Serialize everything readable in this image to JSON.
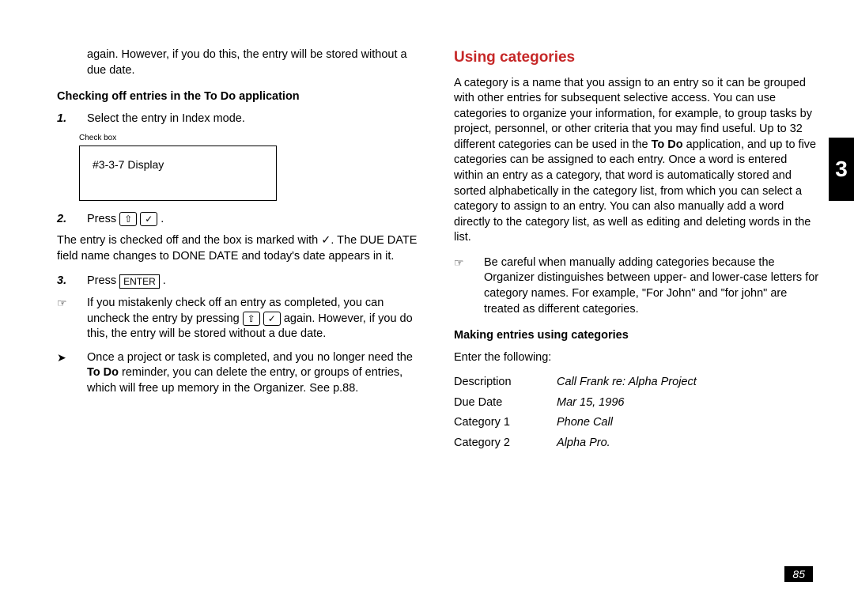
{
  "chapterNumber": "3",
  "pageNumber": "85",
  "left": {
    "intro": "again. However, if you do this, the entry will be stored without a due date.",
    "heading": "Checking off entries in the To Do application",
    "step1": {
      "num": "1.",
      "text": "Select the entry in Index mode."
    },
    "checkboxLabel": "Check box",
    "displayBox": "#3-3-7 Display",
    "step2": {
      "num": "2.",
      "pressWord": "Press ",
      "period": " ."
    },
    "shiftKey": "⇧",
    "checkKey": "✓",
    "afterStep2": "The entry is checked off and the box is marked with ✓. The DUE DATE field name changes to DONE DATE and today's date appears in it.",
    "step3": {
      "num": "3.",
      "pressWord": "Press ",
      "enterKey": "ENTER",
      "period": " ."
    },
    "noteIcon": "☞",
    "note1a": "If you mistakenly check off an entry as completed, you can uncheck the entry by pressing ",
    "note1b": " again. However, if you do this, the entry will be stored without a due date.",
    "arrowIcon": "➤",
    "note2a": "Once a project or task is completed, and you no longer need the ",
    "note2bold": "To Do",
    "note2b": " reminder, you can delete the entry, or groups of entries, which will free up memory in the Organizer. See p.88."
  },
  "right": {
    "sectionTitle": "Using categories",
    "para1a": "A category is a name that you assign to an entry so it can be grouped with other entries for subsequent selective access. You can use categories to organize your information, for example, to group tasks by project, personnel, or other criteria that you may find useful. Up to 32 different categories can be used in the ",
    "para1bold": "To Do",
    "para1b": " application, and up to five categories can be assigned to each entry. Once a word is entered within an entry as a category, that word is automatically stored and sorted alphabetically in the category list, from which you can select a category to assign to an entry. You can also manually add a word directly to the category list, as well as editing and deleting words in the list.",
    "noteIcon": "☞",
    "note": "Be careful when manually adding categories because the Organizer distinguishes between upper- and lower-case letters for category names. For example, \"For John\" and \"for john\" are treated as different categories.",
    "heading2": "Making entries using categories",
    "enterText": "Enter the following:",
    "rows": {
      "r1": {
        "label": "Description",
        "value": "Call Frank re: Alpha Project"
      },
      "r2": {
        "label": "Due Date",
        "value": "Mar 15, 1996"
      },
      "r3": {
        "label": "Category 1",
        "value": "Phone Call"
      },
      "r4": {
        "label": "Category 2",
        "value": "Alpha Pro."
      }
    }
  }
}
